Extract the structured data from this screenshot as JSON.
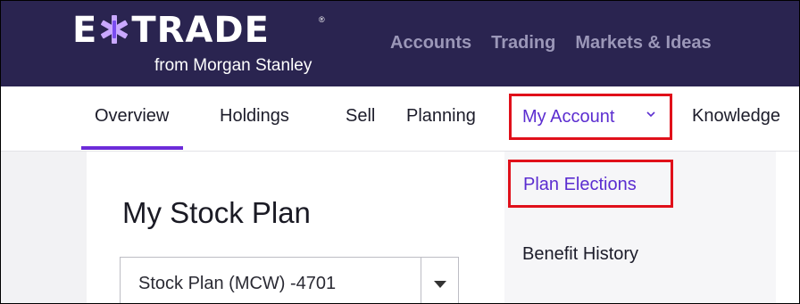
{
  "brand": {
    "logo_text": "E*TRADE",
    "logo_left": "E",
    "logo_right": "TRADE",
    "registered": "®",
    "sub_text": "from Morgan Stanley",
    "colors": {
      "topbar": "#2a2450",
      "accent_purple": "#5b2dd0",
      "highlight_red": "#e0101a"
    }
  },
  "top_nav": {
    "items": [
      {
        "label": "Accounts"
      },
      {
        "label": "Trading"
      },
      {
        "label": "Markets & Ideas"
      }
    ]
  },
  "sub_nav": {
    "items": [
      {
        "label": "Overview",
        "active": true
      },
      {
        "label": "Holdings"
      },
      {
        "label": "Sell"
      },
      {
        "label": "Planning"
      },
      {
        "label": "My Account",
        "icon": "chevron-down-icon",
        "highlighted": true
      },
      {
        "label": "Knowledge"
      }
    ]
  },
  "main": {
    "title": "My Stock Plan",
    "plan_select": {
      "value": "Stock Plan (MCW) -4701",
      "icon": "caret-down-icon"
    }
  },
  "dropdown": {
    "items": [
      {
        "label": "Plan Elections",
        "highlighted": true
      },
      {
        "label": "Benefit History"
      }
    ]
  }
}
